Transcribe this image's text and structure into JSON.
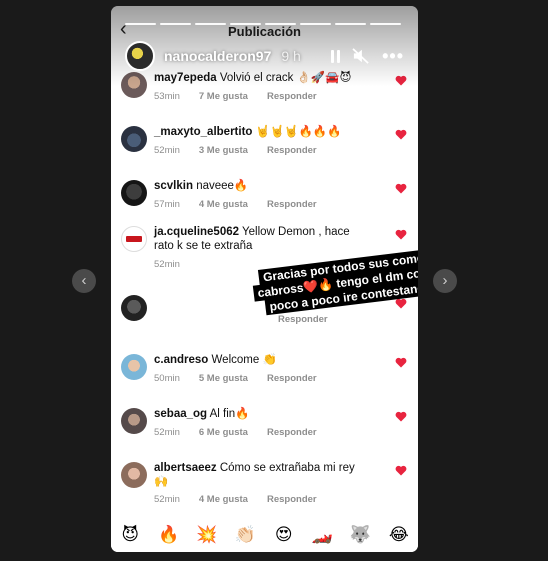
{
  "story": {
    "title": "Publicación",
    "progress_segments": 8,
    "username": "nanocalderon97",
    "time_ago": "9 h"
  },
  "comments": [
    {
      "user": "may7epeda",
      "text": "Volvió el crack 👌🏻🚀🚘😈",
      "time": "53min",
      "likes": "7 Me gusta",
      "reply": "Responder"
    },
    {
      "user": "_maxyto_albertito",
      "text": "🤘🤘🤘🔥🔥🔥",
      "time": "52min",
      "likes": "3 Me gusta",
      "reply": "Responder"
    },
    {
      "user": "scvlkin",
      "text": "naveee🔥",
      "time": "57min",
      "likes": "4 Me gusta",
      "reply": "Responder"
    },
    {
      "user": "ja.cqueline5062",
      "text": "Yellow Demon , hace rato k se te extraña",
      "time": "52min",
      "likes": "",
      "reply": ""
    },
    {
      "user": "",
      "text": "",
      "time": "",
      "likes": "",
      "reply": "Responder"
    },
    {
      "user": "c.andreso",
      "text": "Welcome 👏",
      "time": "50min",
      "likes": "5 Me gusta",
      "reply": "Responder"
    },
    {
      "user": "sebaa_og",
      "text": "Al fin🔥",
      "time": "52min",
      "likes": "6 Me gusta",
      "reply": "Responder"
    },
    {
      "user": "albertsaeez",
      "text": "Cómo se extrañaba mi rey 🙌",
      "time": "52min",
      "likes": "4 Me gusta",
      "reply": "Responder"
    }
  ],
  "overlay_text": "Gracias por todos sus comentarios cabross❤️🔥 tengo el dm colapsau😂 poco a poco ire contestandolos🤘🏻",
  "emoji_bar": [
    "😈",
    "🔥",
    "💥",
    "👏🏻",
    "😍",
    "🏎️",
    "🐺",
    "😂"
  ],
  "colors": {
    "heart": "#e8243f",
    "page_bg": "#1a1a1a",
    "meta_text": "#8e8e8e"
  },
  "icons": {
    "back": "chevron-left-icon",
    "pause": "pause-icon",
    "mute": "muted-speaker-icon",
    "more": "more-icon",
    "prev": "chevron-left-icon",
    "next": "chevron-right-icon"
  }
}
